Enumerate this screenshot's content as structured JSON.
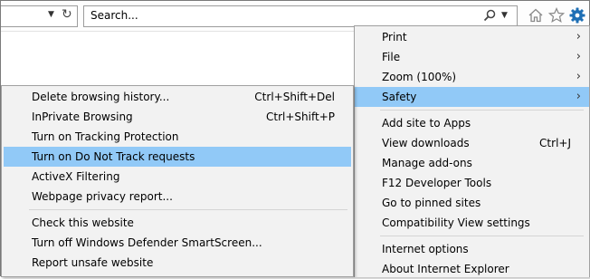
{
  "search": {
    "placeholder": "Search..."
  },
  "toolbar": {
    "icons": [
      "dropdown-arrow-icon",
      "refresh-icon",
      "search-icon",
      "home-icon",
      "favorites-star-icon",
      "gear-icon"
    ],
    "accent": "#1e6fb5"
  },
  "tools_menu": {
    "items": [
      {
        "label": "Print",
        "submenu": true
      },
      {
        "label": "File",
        "submenu": true
      },
      {
        "label": "Zoom (100%)",
        "submenu": true
      },
      {
        "label": "Safety",
        "submenu": true,
        "highlighted": true
      },
      {
        "label": "Add site to Apps"
      },
      {
        "label": "View downloads",
        "shortcut": "Ctrl+J"
      },
      {
        "label": "Manage add-ons"
      },
      {
        "label": "F12 Developer Tools"
      },
      {
        "label": "Go to pinned sites"
      },
      {
        "label": "Compatibility View settings"
      },
      {
        "label": "Internet options"
      },
      {
        "label": "About Internet Explorer"
      }
    ]
  },
  "safety_menu": {
    "items": [
      {
        "label": "Delete browsing history...",
        "shortcut": "Ctrl+Shift+Del"
      },
      {
        "label": "InPrivate Browsing",
        "shortcut": "Ctrl+Shift+P"
      },
      {
        "label": "Turn on Tracking Protection"
      },
      {
        "label": "Turn on Do Not Track requests",
        "highlighted": true
      },
      {
        "label": "ActiveX Filtering"
      },
      {
        "label": "Webpage privacy report..."
      },
      {
        "label": "Check this website"
      },
      {
        "label": "Turn off Windows Defender SmartScreen..."
      },
      {
        "label": "Report unsafe website"
      }
    ]
  },
  "colors": {
    "highlight": "#91c9f7",
    "menu_bg": "#f2f2f2"
  }
}
